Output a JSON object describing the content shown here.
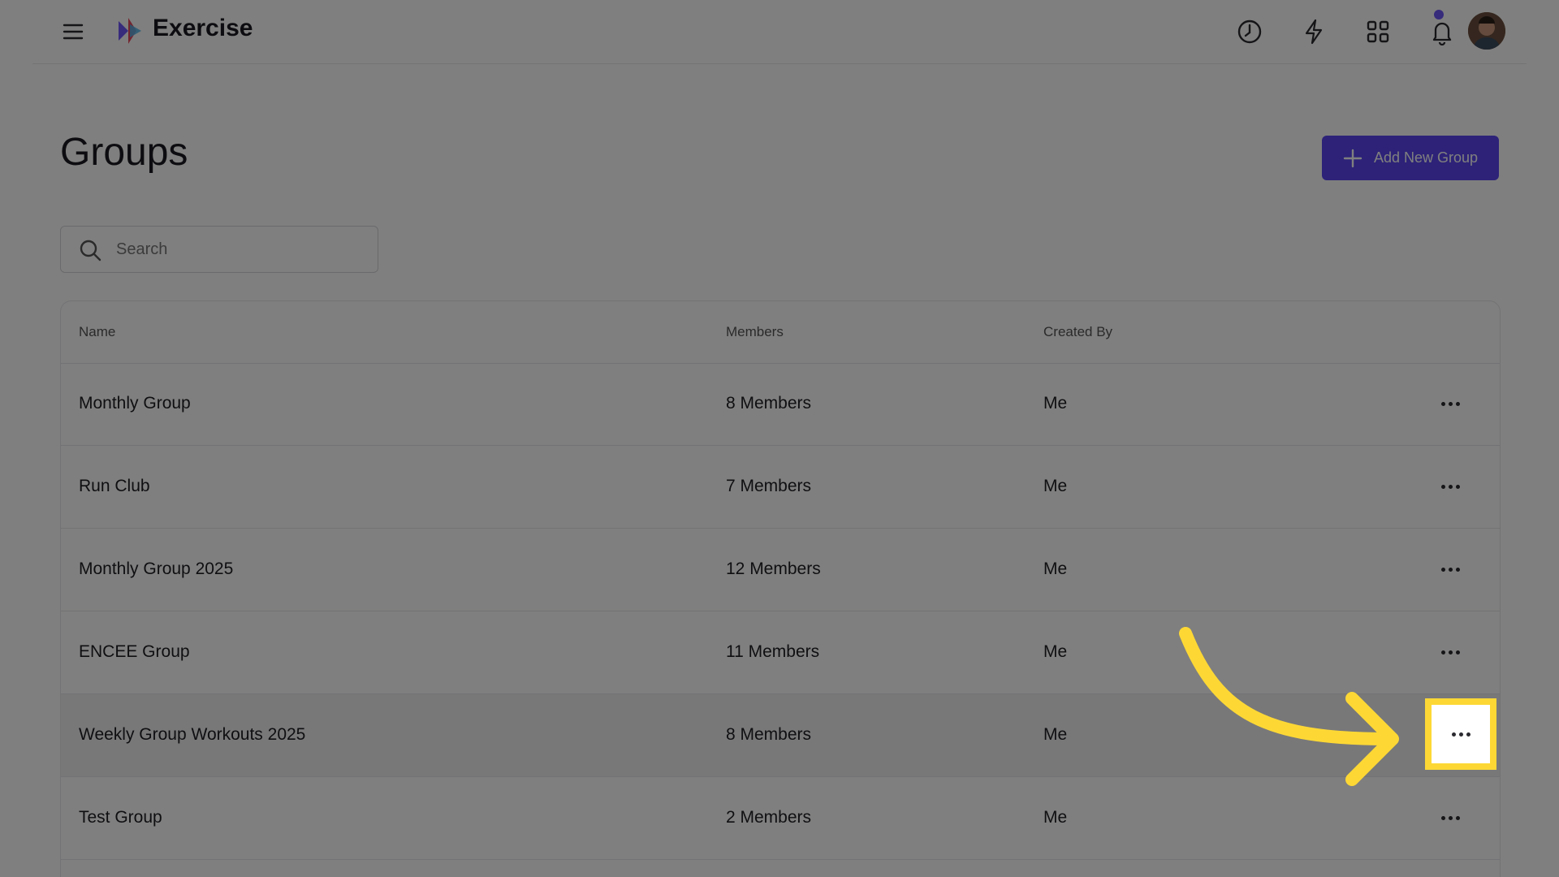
{
  "app": {
    "title": "Exercise"
  },
  "page": {
    "title": "Groups",
    "add_button_label": "Add New Group"
  },
  "search": {
    "placeholder": "Search",
    "value": ""
  },
  "table": {
    "headers": {
      "name": "Name",
      "members": "Members",
      "created_by": "Created By"
    },
    "rows": [
      {
        "name": "Monthly Group",
        "members": "8 Members",
        "created_by": "Me"
      },
      {
        "name": "Run Club",
        "members": "7 Members",
        "created_by": "Me"
      },
      {
        "name": "Monthly Group 2025",
        "members": "12 Members",
        "created_by": "Me"
      },
      {
        "name": "ENCEE Group",
        "members": "11 Members",
        "created_by": "Me"
      },
      {
        "name": "Weekly Group Workouts 2025",
        "members": "8 Members",
        "created_by": "Me",
        "highlighted": true
      },
      {
        "name": "Test Group",
        "members": "2 Members",
        "created_by": "Me"
      }
    ]
  },
  "icons": {
    "menu": "hamburger-icon",
    "history": "clock-icon",
    "actions": "lightning-icon",
    "apps": "grid-icon",
    "notifications": "bell-icon",
    "row_menu": "more-horizontal-icon"
  },
  "colors": {
    "accent": "#5b45f0",
    "notification_dot": "#6e56f8",
    "highlight": "#fdd835"
  }
}
